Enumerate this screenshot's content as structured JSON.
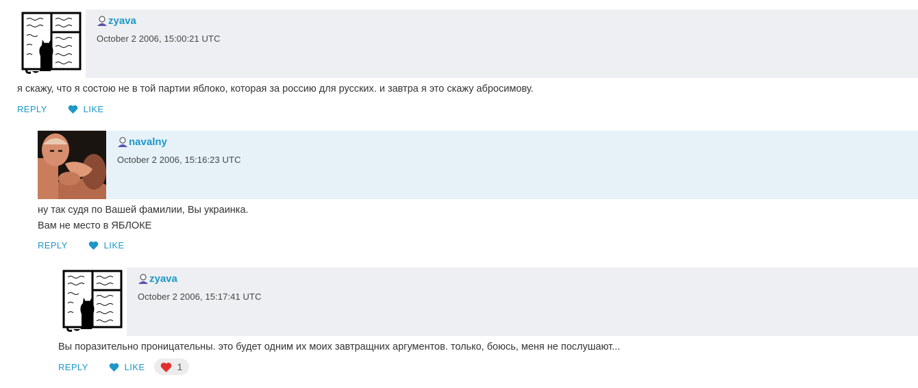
{
  "comments": [
    {
      "username": "zyava",
      "timestamp": "October 2 2006, 15:00:21 UTC",
      "lines": [
        "я скажу, что я состою не в той партии яблоко, которая за россию для русских. и завтра я это скажу абросимову."
      ],
      "reply_label": "REPLY",
      "like_label": "LIKE",
      "band_color": "#edeff2",
      "avatar": "cat-window-drawing"
    },
    {
      "username": "navalny",
      "timestamp": "October 2 2006, 15:16:23 UTC",
      "lines": [
        "ну так судя по Вашей фамилии, Вы украинка.",
        "Вам не место в ЯБЛОКЕ"
      ],
      "reply_label": "REPLY",
      "like_label": "LIKE",
      "band_color": "#e6f2f8",
      "avatar": "wrestler-photo"
    },
    {
      "username": "zyava",
      "timestamp": "October 2 2006, 15:17:41 UTC",
      "lines": [
        "Вы поразительно проницательны. это будет одним их моих завтращних аргументов. только, боюсь, меня не послушают..."
      ],
      "reply_label": "REPLY",
      "like_label": "LIKE",
      "like_count": "1",
      "band_color": "#edeff2",
      "avatar": "cat-window-drawing"
    }
  ],
  "icons": {
    "user": "user-icon",
    "like": "heart-icon",
    "liked": "red-heart-icon"
  },
  "colors": {
    "link": "#1d97c5",
    "heart_liked": "#e0312f"
  }
}
